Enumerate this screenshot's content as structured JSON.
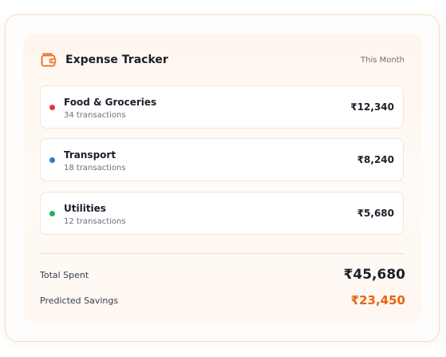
{
  "header": {
    "title": "Expense Tracker",
    "period": "This Month",
    "icon": "wallet-icon",
    "accent_color": "#f26a1b"
  },
  "expenses": [
    {
      "name": "Food & Groceries",
      "subtitle": "34 transactions",
      "amount": "₹12,340",
      "dot_color": "#e53939"
    },
    {
      "name": "Transport",
      "subtitle": "18 transactions",
      "amount": "₹8,240",
      "dot_color": "#2f74e0"
    },
    {
      "name": "Utilities",
      "subtitle": "12 transactions",
      "amount": "₹5,680",
      "dot_color": "#20b35a"
    }
  ],
  "summary": {
    "total_label": "Total Spent",
    "total_value": "₹45,680",
    "savings_label": "Predicted Savings",
    "savings_value": "₹23,450",
    "savings_color": "#e8650f"
  }
}
